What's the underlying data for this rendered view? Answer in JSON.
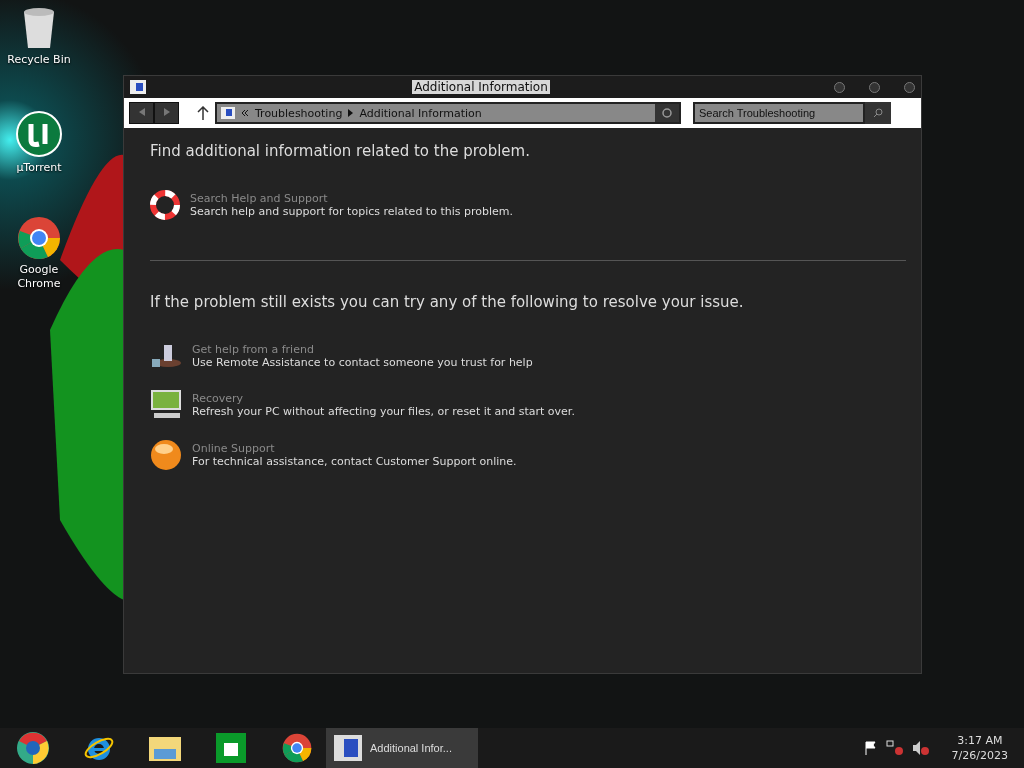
{
  "desktop_icons": [
    {
      "label": "Recycle Bin",
      "kind": "bin"
    },
    {
      "label": "µTorrent",
      "kind": "torrent"
    },
    {
      "label": "Google Chrome",
      "kind": "chrome"
    }
  ],
  "window": {
    "title": "Additional Information",
    "address": {
      "breadcrumbs": [
        "Troubleshooting",
        "Additional Information"
      ]
    },
    "search": {
      "placeholder": "Search Troubleshooting"
    },
    "intro": "Find additional information related to the problem.",
    "help_items": [
      {
        "title": "Search Help and Support",
        "description": "Search help and support for topics related to this problem.",
        "kind": "lifebuoy"
      }
    ],
    "resolve_heading": "If the problem still exists you can try any of the following to resolve your issue.",
    "resolve_items": [
      {
        "title": "Get help from a friend",
        "description": "Use Remote Assistance to contact someone you trust for help",
        "kind": "remote"
      },
      {
        "title": "Recovery",
        "description": "Refresh your PC without affecting your files, or reset it and start over.",
        "kind": "monitor"
      },
      {
        "title": "Online Support",
        "description": "For technical assistance, contact Customer Support online.",
        "kind": "globe"
      }
    ]
  },
  "taskbar": {
    "pinned": [
      {
        "kind": "chromium"
      },
      {
        "kind": "ie"
      },
      {
        "kind": "folder"
      },
      {
        "kind": "store"
      },
      {
        "kind": "chrome"
      }
    ],
    "tasks": [
      {
        "label": "Additional Infor...",
        "selected": true
      }
    ],
    "clock": {
      "time": "3:17 AM",
      "date": "7/26/2023"
    }
  }
}
